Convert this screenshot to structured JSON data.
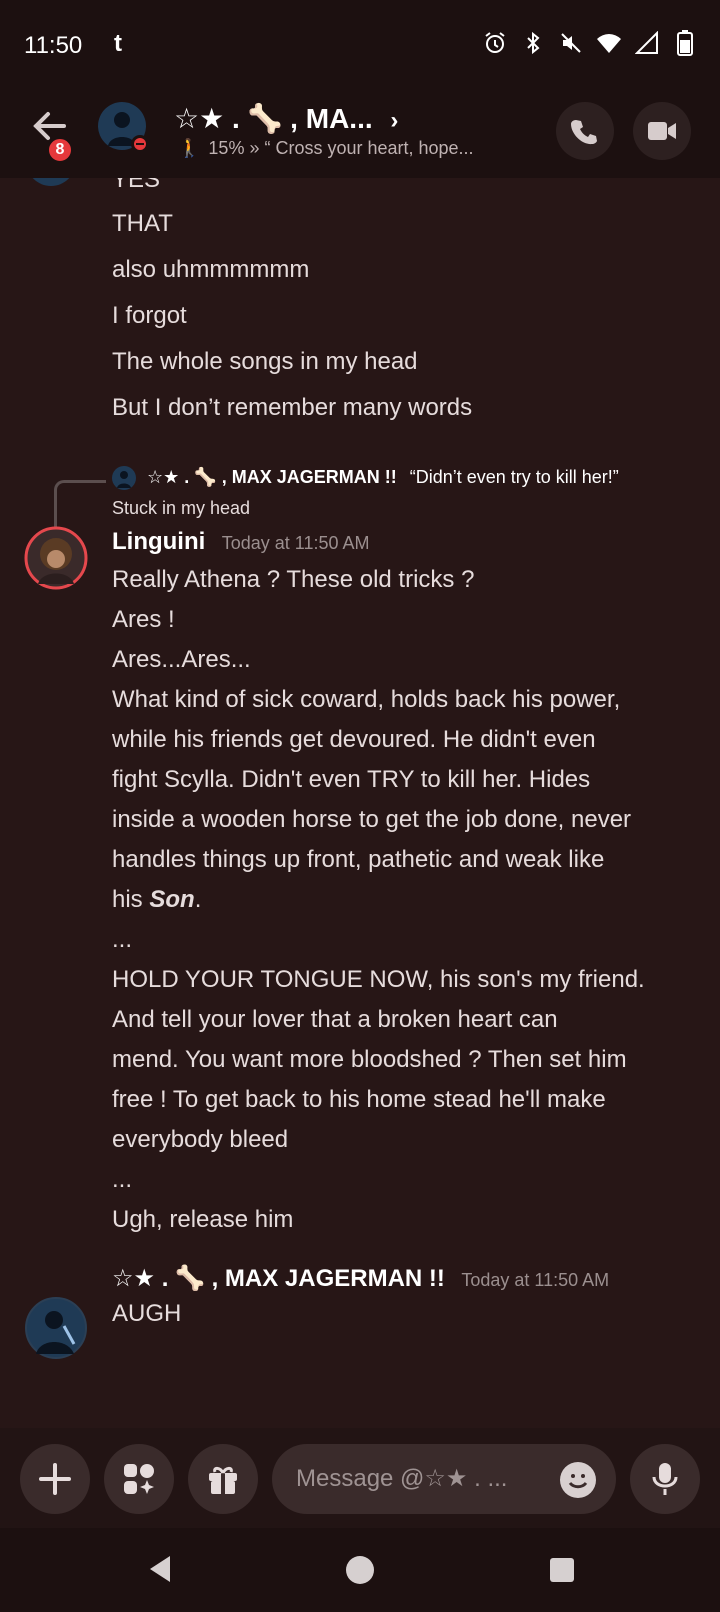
{
  "status_bar": {
    "time": "11:50",
    "app_icon": "t",
    "icons": [
      "alarm-icon",
      "bluetooth-icon",
      "mute-icon",
      "wifi-icon",
      "signal-icon",
      "battery-icon"
    ]
  },
  "header": {
    "back_badge": "8",
    "title": "☆★ . 🦴 , MA...",
    "title_chevron": "›",
    "subtitle": "15%  »  “ Cross your heart,  hope..."
  },
  "prev_lines": [
    "YES",
    "THAT",
    "also uhmmmmmm",
    "I forgot",
    "The whole songs in my head",
    "But I don’t remember many words"
  ],
  "reply": {
    "author": "☆★ . 🦴 , MAX JAGERMAN !!",
    "quote": "“Didn’t even try to kill her!”",
    "text": "Stuck in my head"
  },
  "message1": {
    "author": "Linguini",
    "timestamp": "Today at 11:50 AM",
    "lines": [
      "Really Athena ? These old tricks ?",
      "Ares !",
      "Ares...Ares...",
      "What kind of sick coward, holds back his power,",
      "while his friends get devoured. He didn't even",
      "fight Scylla. Didn't even TRY to kill her. Hides",
      "inside a wooden horse to get the job done, never",
      "handles things up front, pathetic and weak like",
      "his ",
      "...",
      "HOLD YOUR TONGUE NOW, his son's my friend.",
      "And tell your lover that a broken heart can",
      "mend. You want more bloodshed ? Then set him",
      "free ! To get back to his home stead he'll make",
      "everybody bleed",
      "...",
      "Ugh, release him"
    ],
    "emphasis": "Son",
    "emphasis_after": "."
  },
  "message2": {
    "author": "☆★ . 🦴 , MAX JAGERMAN !!",
    "timestamp": "Today at 11:50 AM",
    "text": "AUGH"
  },
  "composer": {
    "placeholder": "Message @☆★ . ..."
  },
  "colors": {
    "background": "#271616",
    "header": "#1c1010",
    "badge": "#e5383b",
    "timestamp": "#9b8f8f"
  }
}
